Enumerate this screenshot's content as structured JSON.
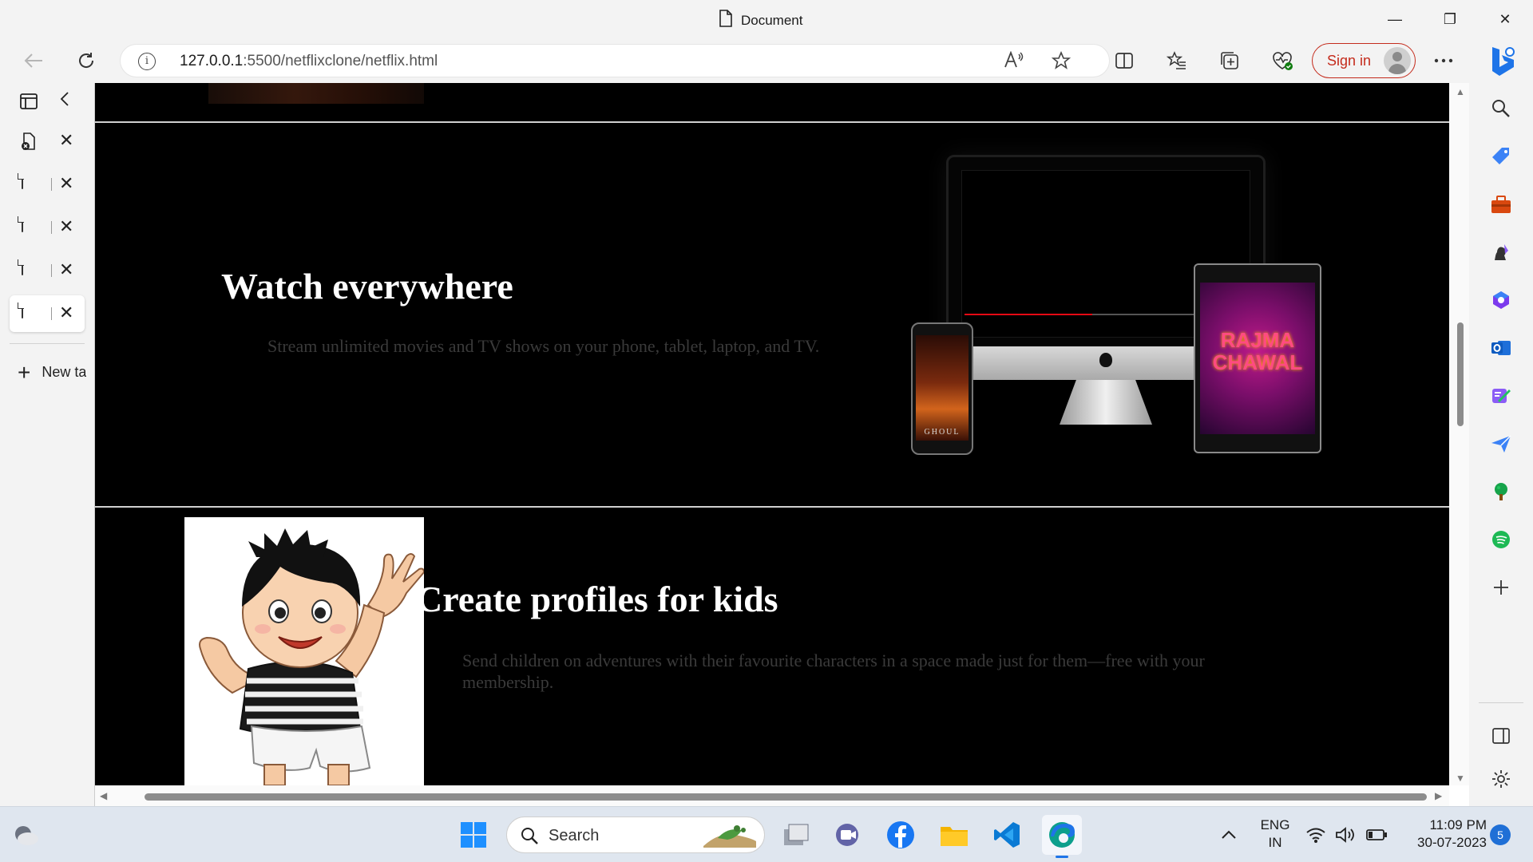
{
  "window": {
    "title": "Document",
    "minimize_glyph": "—",
    "restore_glyph": "❐",
    "close_glyph": "✕"
  },
  "address_bar": {
    "host": "127.0.0.1",
    "path": ":5500/netflixclone/netflix.html",
    "signin_label": "Sign in"
  },
  "tabs": {
    "items": [
      {
        "name": "tab-1"
      },
      {
        "name": "tab-2"
      },
      {
        "name": "tab-3"
      },
      {
        "name": "tab-4"
      },
      {
        "name": "tab-5"
      }
    ],
    "close_glyph": "✕",
    "new_tab_label": "New ta"
  },
  "page": {
    "section1": {
      "title": "Watch everywhere",
      "text": "Stream unlimited movies and TV shows on your phone, tablet, laptop, and TV.",
      "phone_title": "GHOUL",
      "tablet_title": "RAJMA CHAWAL"
    },
    "section2": {
      "title": "Create profiles for kids",
      "text": "Send children on adventures with their favourite characters in a space made just for them—free with your membership."
    }
  },
  "taskbar": {
    "search_label": "Search",
    "lang_line1": "ENG",
    "lang_line2": "IN",
    "time": "11:09 PM",
    "date": "30-07-2023",
    "notification_count": "5"
  },
  "colors": {
    "accent_red": "#c42b1c",
    "netflix_red": "#e50914",
    "page_bg": "#000000"
  }
}
